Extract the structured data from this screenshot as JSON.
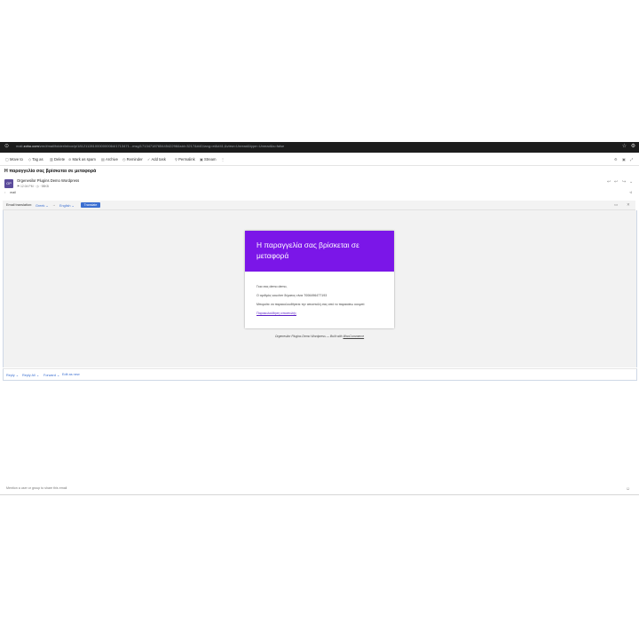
{
  "browser": {
    "url_prefix": "mail.",
    "url_domain": "zoho.com",
    "url_rest": "/zm/#mail/folder/inbox/p/1812112810000000064/1713471...msg/1713471876544542298&sid=3217&#40;lang=el&#41;&view=Unread&type=Unread&s=false"
  },
  "toolbar": {
    "items": [
      {
        "icon": "move-icon",
        "glyph": "▢",
        "label": "Move to"
      },
      {
        "icon": "tag-icon",
        "glyph": "◇",
        "label": "Tag as"
      },
      {
        "icon": "delete-icon",
        "glyph": "▥",
        "label": "Delete"
      },
      {
        "icon": "spam-icon",
        "glyph": "⊘",
        "label": "Mark as spam"
      },
      {
        "icon": "archive-icon",
        "glyph": "▤",
        "label": "Archive"
      },
      {
        "icon": "reminder-icon",
        "glyph": "◷",
        "label": "Reminder"
      },
      {
        "icon": "task-icon",
        "glyph": "✓",
        "label": "Add task"
      },
      {
        "icon": "permalink-icon",
        "glyph": "⚲",
        "label": "Permalink"
      },
      {
        "icon": "stream-icon",
        "glyph": "▣",
        "label": "Stream"
      }
    ],
    "more_glyph": "⋮"
  },
  "message": {
    "subject": "Η παραγγελία σας βρίσκεται σε μεταφορά",
    "avatar_initials": "OP",
    "sender_name": "Orgenesilor Plugins Demo Wordpress",
    "meta_time": "12:04 PM",
    "meta_size": "98KB",
    "to_label": "mail"
  },
  "translate": {
    "label": "Email translation:",
    "from_lang": "Greek",
    "arrow": "→",
    "to_lang": "English",
    "button_label": "Translate"
  },
  "email_body": {
    "title": "Η παραγγελία σας βρίσκεται σε μεταφορά",
    "greeting": "Γεια σας demo demo,",
    "voucher": "Ο αριθμός voucher δέματος είναι 7006496477193",
    "tracking_text": "Μπορείτε να παρακολουθήσετε την αποστολή σας από το παρακάτω κουμπί:",
    "link_label": "Παρακολούθηση αποστολής",
    "footer_text": "Orgenesilor Plugins Demo Wordpress — Built with ",
    "footer_link": "WooCommerce"
  },
  "reply_bar": {
    "reply": "Reply",
    "reply_all": "Reply All",
    "forward": "Forward",
    "edit_as_new": "Edit as new"
  },
  "footer": {
    "hint": "Mention a user or group to share this email"
  }
}
